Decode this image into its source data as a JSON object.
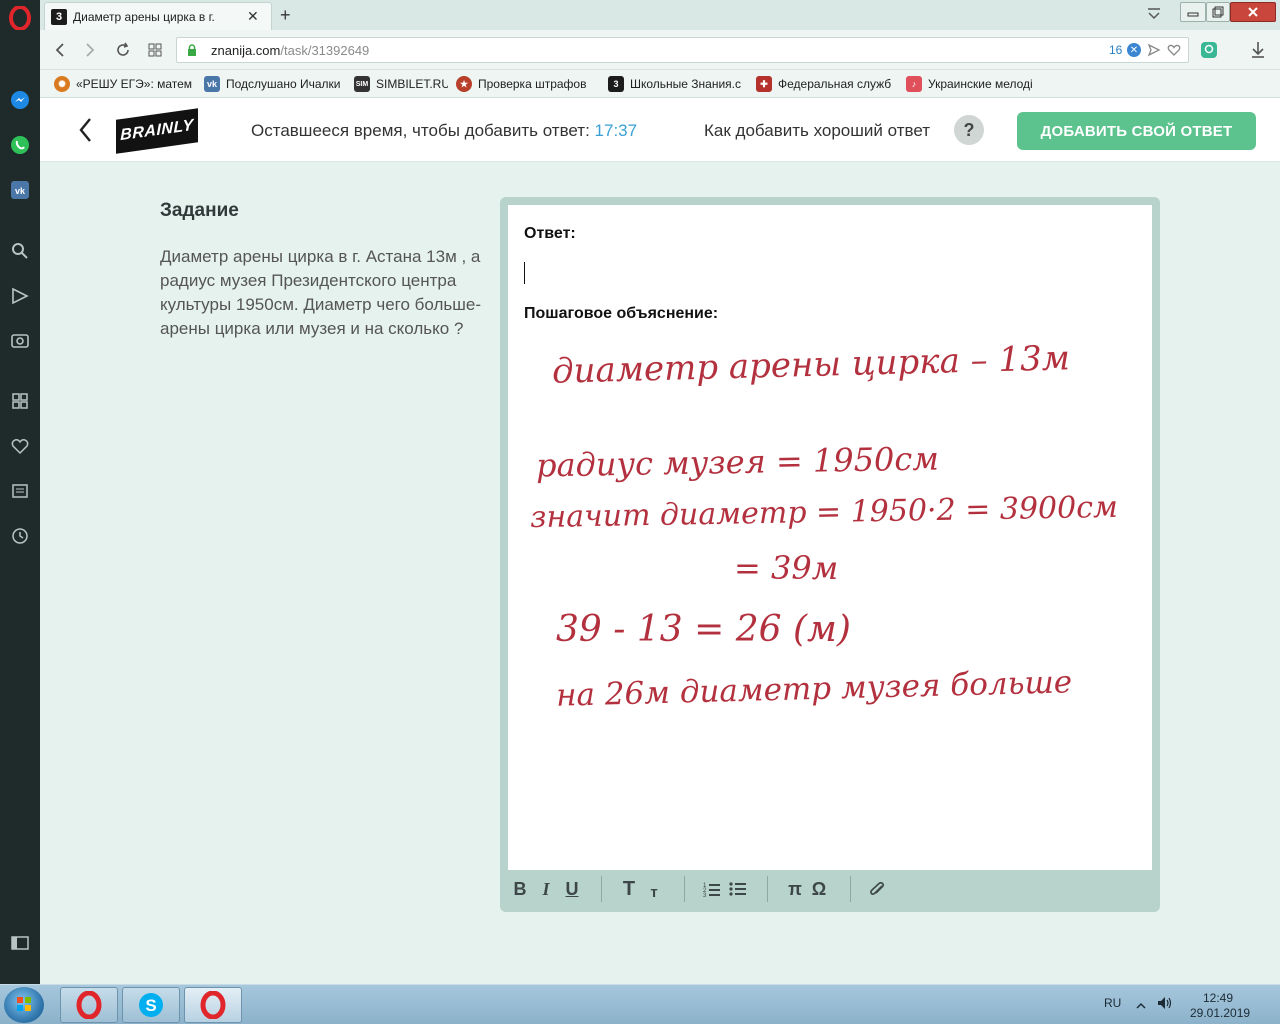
{
  "browser": {
    "tab_title": "Диаметр арены цирка в г.",
    "tab_favicon": "3",
    "url_host": "znanija.com",
    "url_path": "/task/31392649",
    "adblock_count": "16"
  },
  "bookmarks": [
    {
      "label": "«РЕШУ ЕГЭ»: матема",
      "icon": "sun-icon",
      "color": "#d97a20"
    },
    {
      "label": "Подслушано Ичалки",
      "icon": "vk-icon",
      "color": "#4a76a8"
    },
    {
      "label": "SIMBILET.RU",
      "icon": "sim-icon",
      "color": "#333333"
    },
    {
      "label": "Проверка штрафов",
      "icon": "emblem-icon",
      "color": "#b8402a"
    },
    {
      "label": "Школьные Знания.c",
      "icon": "znanija-icon",
      "color": "#1c1c1c"
    },
    {
      "label": "Федеральная служб",
      "icon": "federal-icon",
      "color": "#b5312b"
    },
    {
      "label": "Украинские мелоді",
      "icon": "music-icon",
      "color": "#e0505a"
    }
  ],
  "header": {
    "logo_text": "BRAINLY",
    "timer_label": "Оставшееся время, чтобы добавить ответ: ",
    "timer_value": "17:37",
    "howto_label": "Как добавить хороший ответ",
    "help_symbol": "?",
    "add_answer_label": "ДОБАВИТЬ СВОЙ ОТВЕТ"
  },
  "task": {
    "heading": "Задание",
    "text": "Диаметр арены цирка в г. Астана 13м , а радиус музея Президентского центра культуры 1950см. Диаметр чего больше- арены цирка или музея и на сколько ?"
  },
  "editor": {
    "answer_label": "Ответ:",
    "explanation_label": "Пошаговое объяснение:",
    "handwriting": [
      "диаметр арены цирка – 13м",
      "радиус музея = 1950см",
      "значит диаметр = 1950·2 = 3900см",
      "= 39м",
      "39 - 13 = 26 (м)",
      "на 26м диаметр музея больше"
    ],
    "toolbar": {
      "bold": "B",
      "italic": "I",
      "underline": "U",
      "text_large": "T",
      "text_small": "т",
      "pi": "π",
      "omega": "Ω"
    }
  },
  "taskbar": {
    "language": "RU",
    "time": "12:49",
    "date": "29.01.2019"
  },
  "colors": {
    "accent_green": "#5cc38e",
    "timer_blue": "#3aa0d5",
    "ink": "#b3313e",
    "page_bg": "#e6f2ee"
  }
}
